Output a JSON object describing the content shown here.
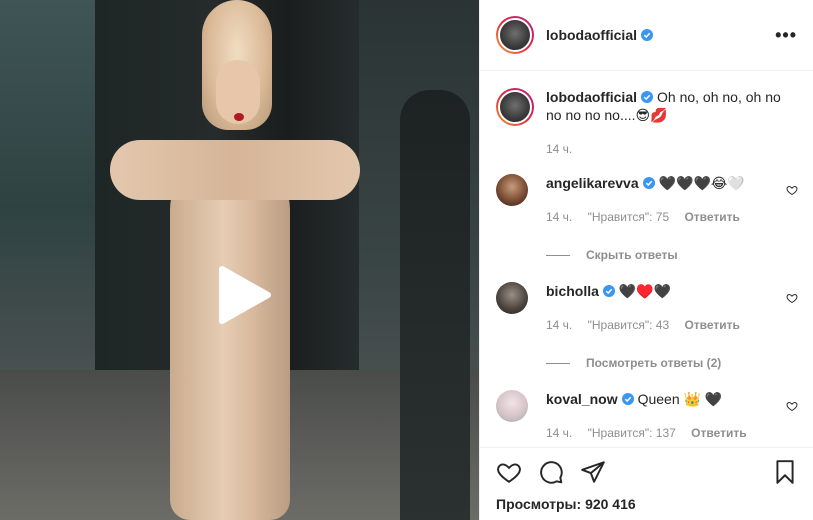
{
  "post": {
    "author": "lobodaofficial",
    "more_label": "•••",
    "caption_text": "Oh no, oh no, oh no no no no no....😎💋",
    "caption_time": "14 ч."
  },
  "comments": [
    {
      "username": "angelikarevva",
      "text": "🖤🖤🖤😂🤍",
      "time": "14 ч.",
      "likes": "\"Нравится\": 75",
      "reply": "Ответить",
      "replies_toggle": "Скрыть ответы"
    },
    {
      "username": "bicholla",
      "text": "🖤♥️🖤",
      "time": "14 ч.",
      "likes": "\"Нравится\": 43",
      "reply": "Ответить",
      "replies_toggle": "Посмотреть ответы (2)"
    },
    {
      "username": "koval_now",
      "text": "Queen 👑 🖤",
      "time": "14 ч.",
      "likes": "\"Нравится\": 137",
      "reply": "Ответить"
    }
  ],
  "stats": {
    "views_label": "Просмотры:",
    "views_count": "920 416"
  },
  "colors": {
    "verified_blue": "#3897f0",
    "muted_text": "#8e8e8e",
    "primary_text": "#262626"
  },
  "icons": [
    "play-icon",
    "verified-icon",
    "heart-icon",
    "comment-icon",
    "share-icon",
    "bookmark-icon",
    "more-icon"
  ]
}
